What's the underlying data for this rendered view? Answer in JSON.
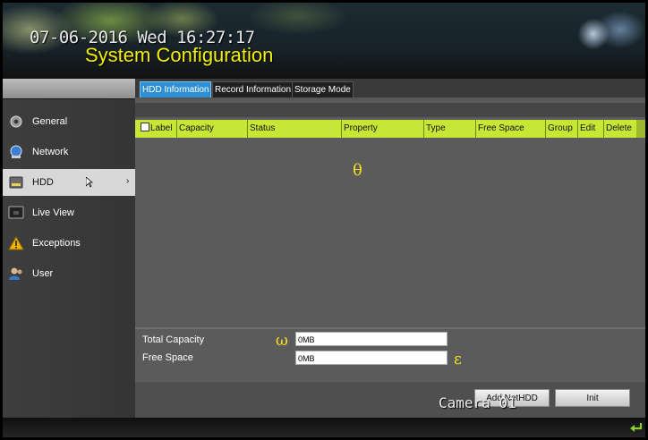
{
  "header": {
    "datetime": "07-06-2016 Wed 16:27:17",
    "title": "System Configuration"
  },
  "tabs": [
    {
      "label": "HDD Information",
      "active": true
    },
    {
      "label": "Record Information",
      "active": false
    },
    {
      "label": "Storage Mode",
      "active": false
    }
  ],
  "sidebar": {
    "items": [
      {
        "label": "General",
        "icon": "gear-icon"
      },
      {
        "label": "Network",
        "icon": "network-icon"
      },
      {
        "label": "HDD",
        "icon": "hdd-icon",
        "active": true
      },
      {
        "label": "Live View",
        "icon": "monitor-icon"
      },
      {
        "label": "Exceptions",
        "icon": "warning-icon"
      },
      {
        "label": "User",
        "icon": "user-icon"
      }
    ]
  },
  "table": {
    "columns": [
      "Label",
      "Capacity",
      "Status",
      "Property",
      "Type",
      "Free Space",
      "Group",
      "Edit",
      "Delete"
    ],
    "rows": []
  },
  "overlay_symbols": {
    "theta": "θ",
    "omega": "ω",
    "epsilon": "ε"
  },
  "summary": {
    "total_capacity_label": "Total Capacity",
    "total_capacity_value": "0MB",
    "free_space_label": "Free Space",
    "free_space_value": "0MB"
  },
  "buttons": {
    "add_nethdd": "Add NetHDD",
    "init": "Init"
  },
  "camera_label": "Camera 01",
  "colors": {
    "header_title": "#f4f000",
    "table_header": "#c8e635",
    "active_tab": "#2f8fd4"
  }
}
